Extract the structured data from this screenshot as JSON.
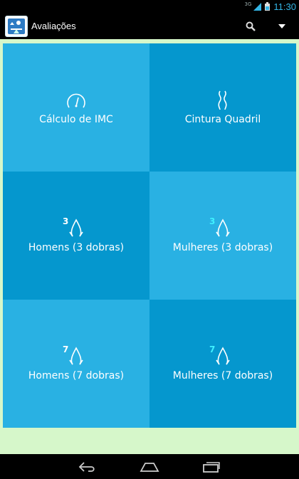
{
  "status": {
    "network": "3G",
    "time": "11:30"
  },
  "actionbar": {
    "title": "Avaliações",
    "search_icon": "search-icon",
    "menu_icon": "dropdown-icon"
  },
  "tiles": [
    {
      "label": "Cálculo de IMC",
      "icon": "gauge-icon"
    },
    {
      "label": "Cintura Quadril",
      "icon": "waves-icon"
    },
    {
      "label": "Homens (3 dobras)",
      "icon": "skinfold-icon",
      "digit": "3"
    },
    {
      "label": "Mulheres (3 dobras)",
      "icon": "skinfold-icon",
      "digit": "3"
    },
    {
      "label": "Homens (7 dobras)",
      "icon": "skinfold-icon",
      "digit": "7"
    },
    {
      "label": "Mulheres (7 dobras)",
      "icon": "skinfold-icon",
      "digit": "7"
    }
  ],
  "colors": {
    "tile_light": "#29b1e3",
    "tile_dark": "#0597ce",
    "background": "#d6f7ca",
    "accent": "#33b5e5",
    "mulheres_digit": "#3ff0ff"
  }
}
